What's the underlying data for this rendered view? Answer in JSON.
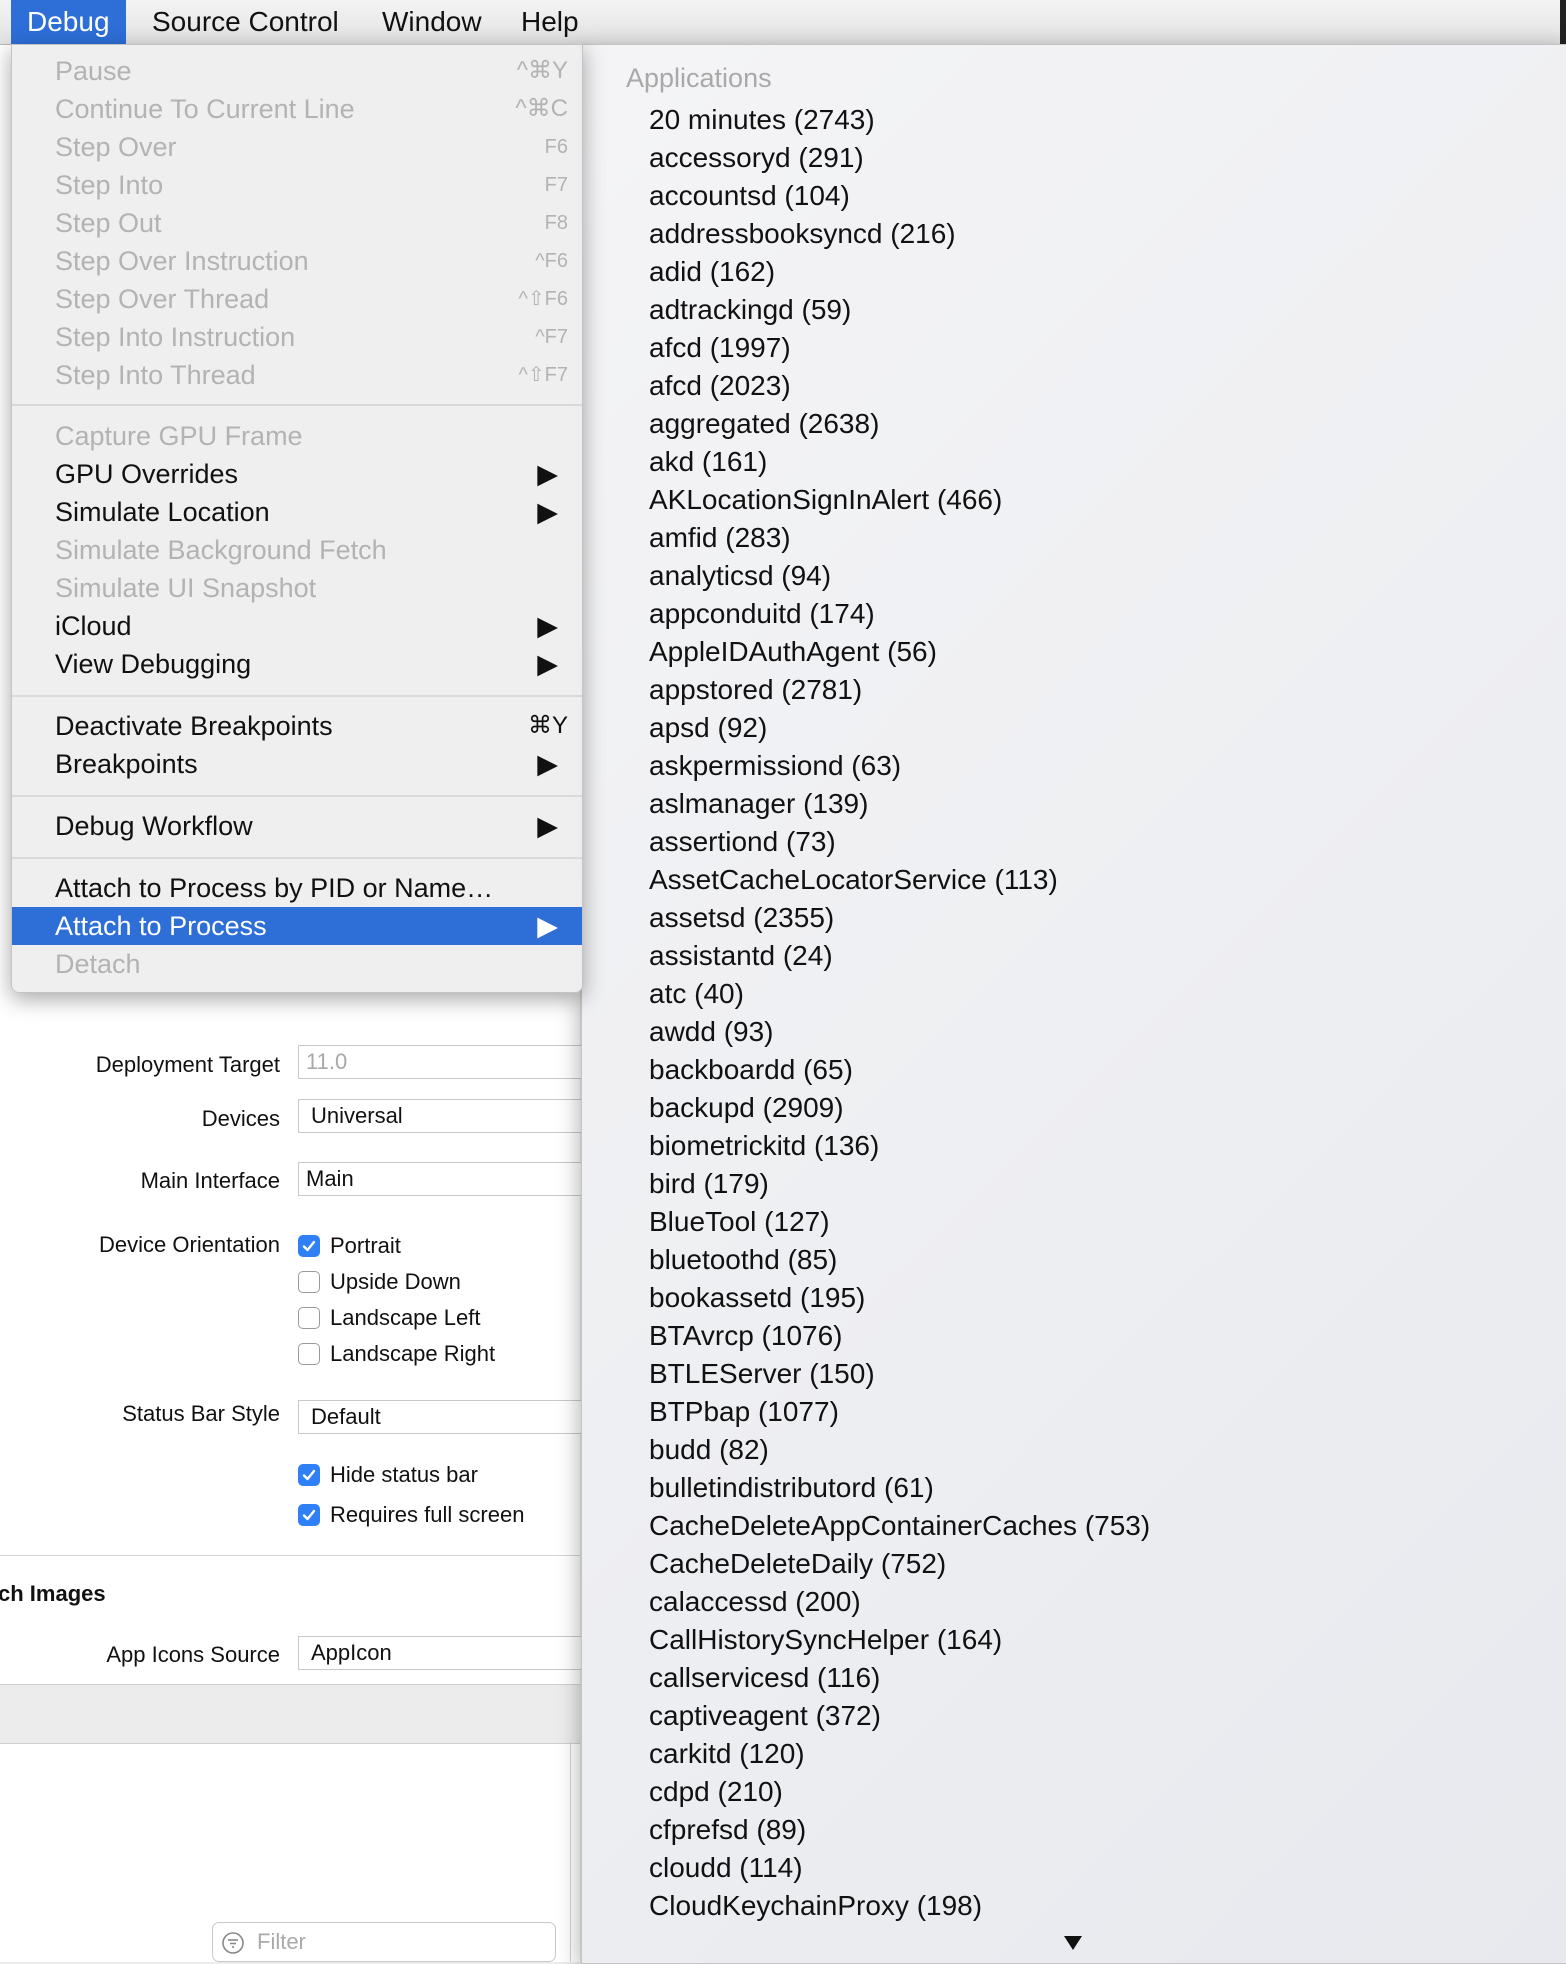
{
  "menubar": {
    "items": [
      "Debug",
      "Source Control",
      "Window",
      "Help"
    ],
    "active": "Debug"
  },
  "debug_menu": {
    "items": [
      {
        "label": "Pause",
        "shortcut": "^⌘Y",
        "enabled": false
      },
      {
        "label": "Continue To Current Line",
        "shortcut": "^⌘C",
        "enabled": false
      },
      {
        "label": "Step Over",
        "shortcut": "F6",
        "enabled": false
      },
      {
        "label": "Step Into",
        "shortcut": "F7",
        "enabled": false
      },
      {
        "label": "Step Out",
        "shortcut": "F8",
        "enabled": false
      },
      {
        "label": "Step Over Instruction",
        "shortcut": "^F6",
        "enabled": false
      },
      {
        "label": "Step Over Thread",
        "shortcut": "^⇧F6",
        "enabled": false
      },
      {
        "label": "Step Into Instruction",
        "shortcut": "^F7",
        "enabled": false
      },
      {
        "label": "Step Into Thread",
        "shortcut": "^⇧F7",
        "enabled": false
      },
      {
        "label": "Capture GPU Frame",
        "enabled": false
      },
      {
        "label": "GPU Overrides",
        "submenu": true,
        "enabled": true
      },
      {
        "label": "Simulate Location",
        "submenu": true,
        "enabled": true
      },
      {
        "label": "Simulate Background Fetch",
        "enabled": false
      },
      {
        "label": "Simulate UI Snapshot",
        "enabled": false
      },
      {
        "label": "iCloud",
        "submenu": true,
        "enabled": true
      },
      {
        "label": "View Debugging",
        "submenu": true,
        "enabled": true
      },
      {
        "label": "Deactivate Breakpoints",
        "shortcut": "⌘Y",
        "enabled": true
      },
      {
        "label": "Breakpoints",
        "submenu": true,
        "enabled": true
      },
      {
        "label": "Debug Workflow",
        "submenu": true,
        "enabled": true
      },
      {
        "label": "Attach to Process by PID or Name…",
        "enabled": true
      },
      {
        "label": "Attach to Process",
        "submenu": true,
        "enabled": true,
        "highlighted": true
      },
      {
        "label": "Detach",
        "enabled": false
      }
    ]
  },
  "process_menu": {
    "header": "Applications",
    "processes": [
      "20 minutes (2743)",
      "accessoryd (291)",
      "accountsd (104)",
      "addressbooksyncd (216)",
      "adid (162)",
      "adtrackingd (59)",
      "afcd (1997)",
      "afcd (2023)",
      "aggregated (2638)",
      "akd (161)",
      "AKLocationSignInAlert (466)",
      "amfid (283)",
      "analyticsd (94)",
      "appconduitd (174)",
      "AppleIDAuthAgent (56)",
      "appstored (2781)",
      "apsd (92)",
      "askpermissiond (63)",
      "aslmanager (139)",
      "assertiond (73)",
      "AssetCacheLocatorService (113)",
      "assetsd (2355)",
      "assistantd (24)",
      "atc (40)",
      "awdd (93)",
      "backboardd (65)",
      "backupd (2909)",
      "biometrickitd (136)",
      "bird (179)",
      "BlueTool (127)",
      "bluetoothd (85)",
      "bookassetd (195)",
      "BTAvrcp (1076)",
      "BTLEServer (150)",
      "BTPbap (1077)",
      "budd (82)",
      "bulletindistributord (61)",
      "CacheDeleteAppContainerCaches (753)",
      "CacheDeleteDaily (752)",
      "calaccessd (200)",
      "CallHistorySyncHelper (164)",
      "callservicesd (116)",
      "captiveagent (372)",
      "carkitd (120)",
      "cdpd (210)",
      "cfprefsd (89)",
      "cloudd (114)",
      "CloudKeychainProxy (198)"
    ]
  },
  "settings": {
    "deployment_target": {
      "label": "Deployment Target",
      "value": "11.0"
    },
    "devices": {
      "label": "Devices",
      "value": "Universal"
    },
    "main_interface": {
      "label": "Main Interface",
      "value": "Main"
    },
    "device_orientation": {
      "label": "Device Orientation",
      "options": [
        {
          "label": "Portrait",
          "checked": true
        },
        {
          "label": "Upside Down",
          "checked": false
        },
        {
          "label": "Landscape Left",
          "checked": false
        },
        {
          "label": "Landscape Right",
          "checked": false
        }
      ]
    },
    "status_bar_style": {
      "label": "Status Bar Style",
      "value": "Default"
    },
    "hide_status_bar": {
      "label": "Hide status bar",
      "checked": true
    },
    "requires_full_screen": {
      "label": "Requires full screen",
      "checked": true
    },
    "section_title": "ch Images",
    "app_icons_source": {
      "label": "App Icons Source",
      "value": "AppIcon"
    },
    "filter_placeholder": "Filter"
  },
  "colors": {
    "accent": "#2d6ed7",
    "checkbox": "#2f7ff5",
    "disabled_text": "#b3b3b3"
  }
}
